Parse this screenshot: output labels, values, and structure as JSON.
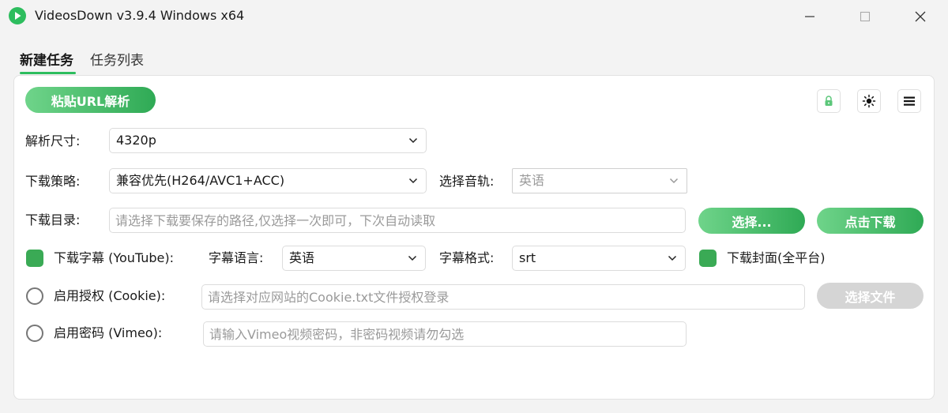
{
  "window": {
    "title": "VideosDown v3.9.4 Windows x64"
  },
  "tabs": [
    {
      "label": "新建任务",
      "active": true
    },
    {
      "label": "任务列表",
      "active": false
    }
  ],
  "toolbar": {
    "paste_url_label": "粘贴URL解析",
    "icons": [
      "lock-icon",
      "sun-icon",
      "menu-icon"
    ]
  },
  "resolution": {
    "label": "解析尺寸:",
    "value": "4320p"
  },
  "strategy": {
    "label": "下载策略:",
    "value": "兼容优先(H264/AVC1+ACC)"
  },
  "audio_track": {
    "label": "选择音轨:",
    "value": "英语"
  },
  "directory": {
    "label": "下载目录:",
    "placeholder": "请选择下载要保存的路径,仅选择一次即可，下次自动读取",
    "choose_label": "选择...",
    "download_label": "点击下载"
  },
  "subtitles": {
    "checkbox_label": "下载字幕 (YouTube):",
    "checked": true,
    "language_label": "字幕语言:",
    "language_value": "英语",
    "format_label": "字幕格式:",
    "format_value": "srt"
  },
  "cover": {
    "checkbox_label": "下载封面(全平台)",
    "checked": true
  },
  "cookie": {
    "checkbox_label": "启用授权 (Cookie):",
    "checked": false,
    "placeholder": "请选择对应网站的Cookie.txt文件授权登录",
    "choose_file_label": "选择文件"
  },
  "vimeo": {
    "checkbox_label": "启用密码 (Vimeo):",
    "checked": false,
    "placeholder": "请输入Vimeo视频密码，非密码视频请勿勾选"
  },
  "colors": {
    "accent": "#2dbd5e",
    "button_gradient_start": "#6fd48a",
    "button_gradient_end": "#2faa55",
    "disabled_button": "#d5d5d5"
  }
}
